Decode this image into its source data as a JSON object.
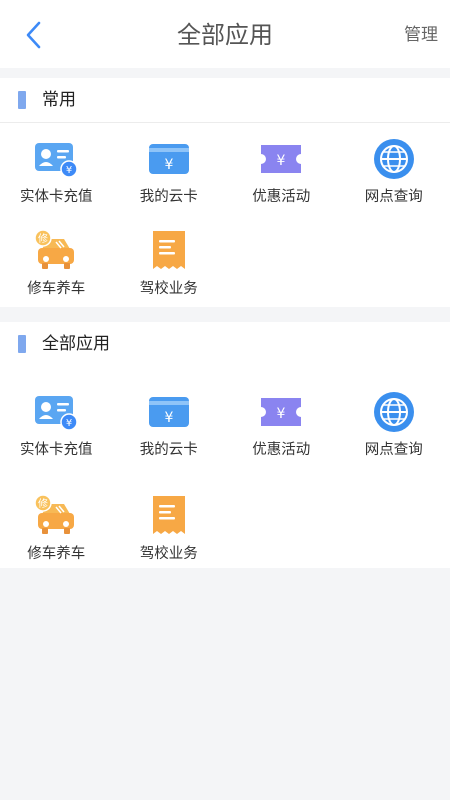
{
  "header": {
    "title": "全部应用",
    "manage_label": "管理"
  },
  "sections": [
    {
      "title": "常用",
      "apps": [
        {
          "label": "实体卡充值",
          "icon": "id-card-recharge-icon"
        },
        {
          "label": "我的云卡",
          "icon": "cloud-card-icon"
        },
        {
          "label": "优惠活动",
          "icon": "coupon-ticket-icon"
        },
        {
          "label": "网点查询",
          "icon": "globe-icon"
        },
        {
          "label": "修车养车",
          "icon": "car-repair-icon"
        },
        {
          "label": "驾校业务",
          "icon": "receipt-icon"
        }
      ]
    },
    {
      "title": "全部应用",
      "apps": [
        {
          "label": "实体卡充值",
          "icon": "id-card-recharge-icon"
        },
        {
          "label": "我的云卡",
          "icon": "cloud-card-icon"
        },
        {
          "label": "优惠活动",
          "icon": "coupon-ticket-icon"
        },
        {
          "label": "网点查询",
          "icon": "globe-icon"
        },
        {
          "label": "修车养车",
          "icon": "car-repair-icon"
        },
        {
          "label": "驾校业务",
          "icon": "receipt-icon"
        }
      ]
    }
  ],
  "colors": {
    "accent": "#3d8af7",
    "section_bar": "#7fa8ee",
    "card_blue": "#4a9bf0",
    "coupon_purple": "#8a84f0",
    "orange": "#f7a845"
  }
}
